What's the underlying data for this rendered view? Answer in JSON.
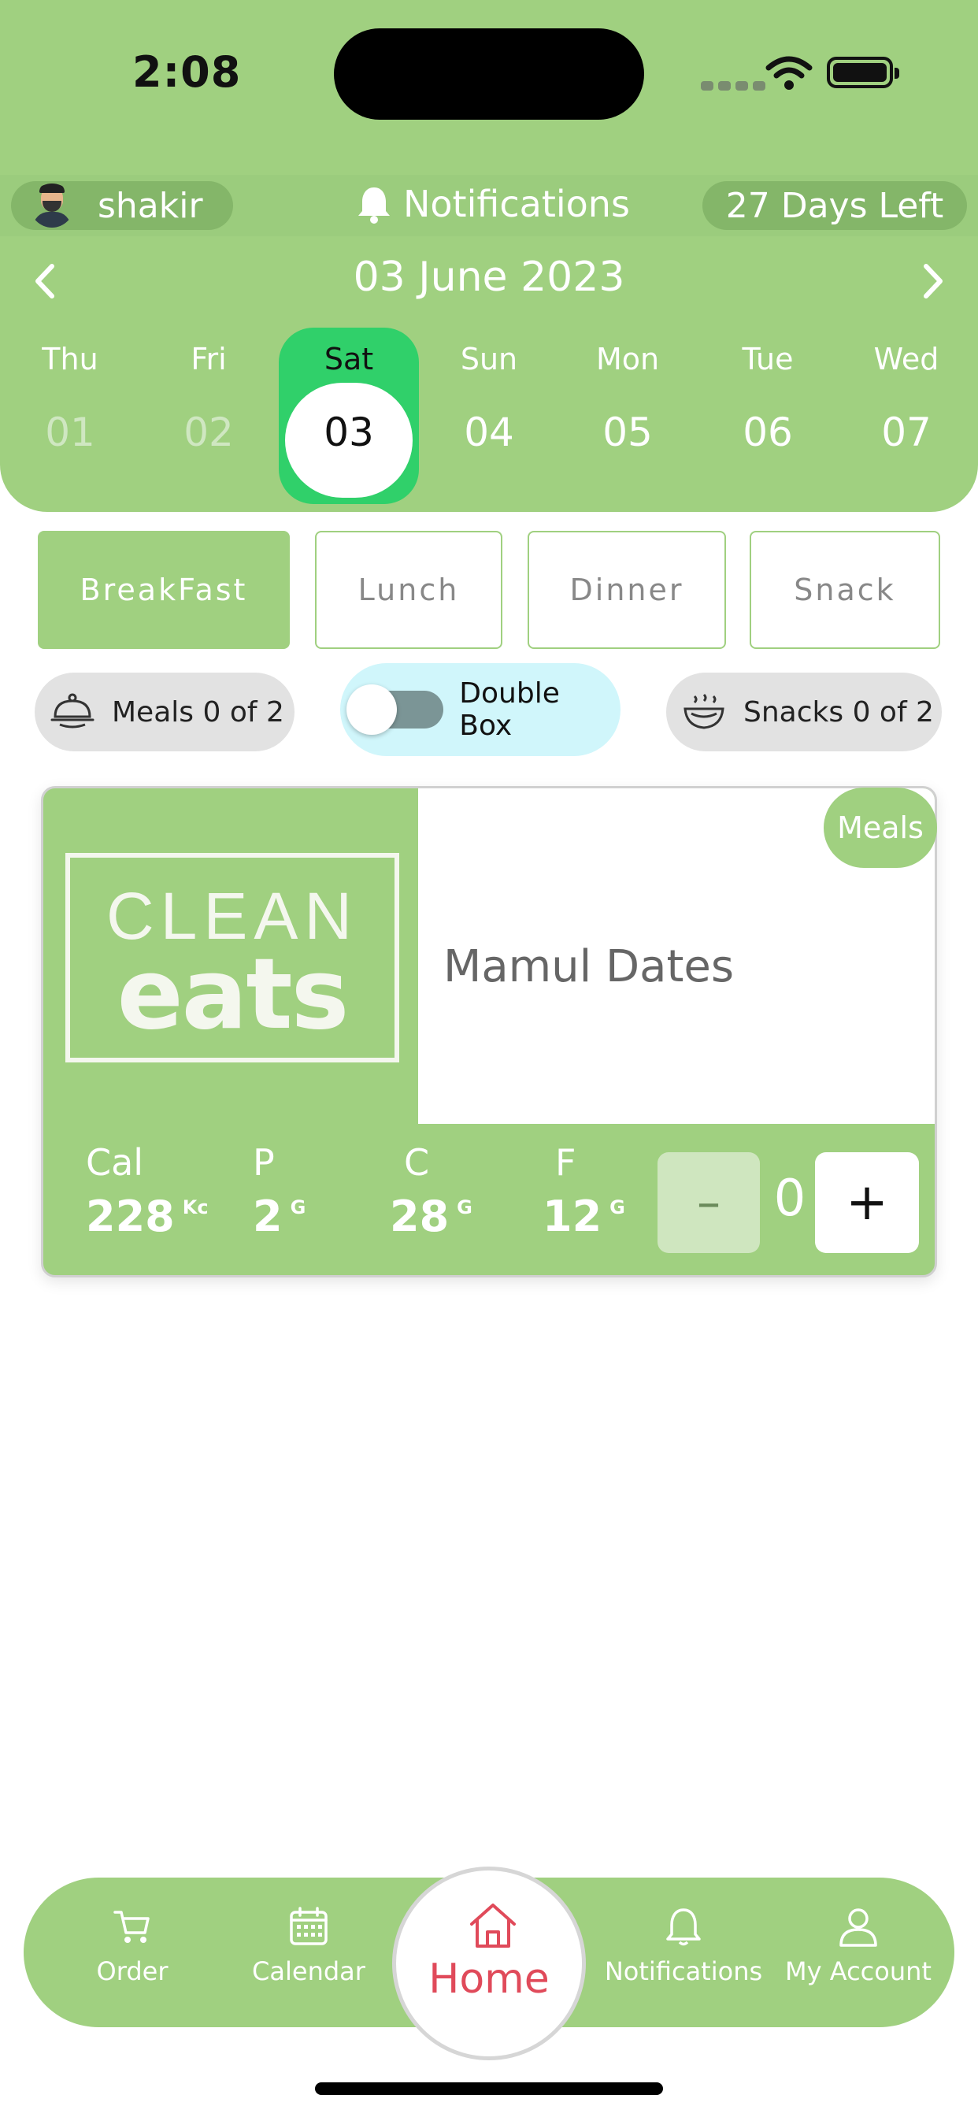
{
  "status_bar": {
    "time": "2:08"
  },
  "header": {
    "user_name": "shakir",
    "notifications_label": "Notifications",
    "days_left": "27 Days Left"
  },
  "calendar": {
    "month_title": "03 June 2023",
    "days": [
      {
        "name": "Thu",
        "num": "01"
      },
      {
        "name": "Fri",
        "num": "02"
      },
      {
        "name": "Sat",
        "num": "03"
      },
      {
        "name": "Sun",
        "num": "04"
      },
      {
        "name": "Mon",
        "num": "05"
      },
      {
        "name": "Tue",
        "num": "06"
      },
      {
        "name": "Wed",
        "num": "07"
      }
    ],
    "selected_day": "03"
  },
  "meal_tabs": [
    "BreakFast",
    "Lunch",
    "Dinner",
    "Snack"
  ],
  "active_tab": "BreakFast",
  "counters": {
    "meals": "Meals 0 of 2",
    "double_box": "Double Box",
    "snacks": "Snacks 0 of 2"
  },
  "double_box_enabled": false,
  "meal_card": {
    "logo_line1": "CLEAN",
    "logo_line2": "eats",
    "name": "Mamul Dates",
    "badge": "Meals",
    "macros": [
      {
        "label": "Cal",
        "value": "228",
        "unit": "Kc"
      },
      {
        "label": "P",
        "value": "2",
        "unit": "G"
      },
      {
        "label": "C",
        "value": "28",
        "unit": "G"
      },
      {
        "label": "F",
        "value": "12",
        "unit": "G"
      }
    ],
    "quantity": "0",
    "minus": "–",
    "plus": "+"
  },
  "bottom_nav": {
    "order": "Order",
    "calendar": "Calendar",
    "home": "Home",
    "notifications": "Notifications",
    "account": "My Account"
  },
  "colors": {
    "primary_green": "#a0d080",
    "selected_day": "#30d06a",
    "home_active": "#e04a5a",
    "double_box_bg": "#d0f6fb"
  }
}
